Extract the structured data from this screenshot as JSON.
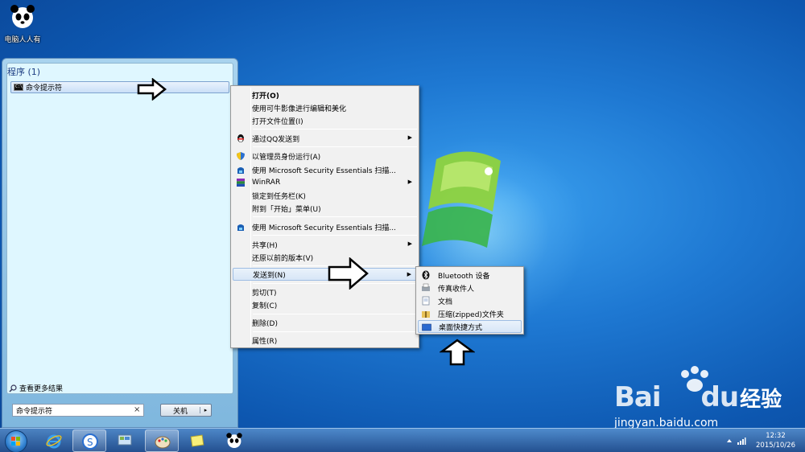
{
  "desktop": {
    "icon_label": "电脑人人有"
  },
  "start_menu": {
    "section_title": "程序 (1)",
    "program": "命令提示符",
    "see_more": "查看更多结果",
    "search_value": "命令提示符",
    "search_clear": "×",
    "shutdown_label": "关机",
    "shutdown_arrow": "▸"
  },
  "context_menu": {
    "items": [
      "打开(O)",
      "使用可牛影像进行编辑和美化",
      "打开文件位置(I)",
      "通过QQ发送到",
      "以管理员身份运行(A)",
      "使用 Microsoft Security Essentials 扫描...",
      "WinRAR",
      "锁定到任务栏(K)",
      "附到「开始」菜单(U)",
      "使用 Microsoft Security Essentials 扫描...",
      "共享(H)",
      "还原以前的版本(V)",
      "发送到(N)",
      "剪切(T)",
      "复制(C)",
      "删除(D)",
      "属性(R)"
    ],
    "submenu_arrow": "▶"
  },
  "send_to": {
    "items": [
      "Bluetooth 设备",
      "传真收件人",
      "文档",
      "压缩(zipped)文件夹",
      "桌面快捷方式"
    ]
  },
  "taskbar": {
    "time": "12:32",
    "date": "2015/10/26"
  },
  "watermark": {
    "brand": "Bai",
    "brand2": "du",
    "cn": "经验",
    "url": "jingyan.baidu.com"
  },
  "colors": {
    "highlight": "#d7e6f7",
    "menu_bg": "#f1f1f1",
    "desktop": "#1e78d2"
  }
}
